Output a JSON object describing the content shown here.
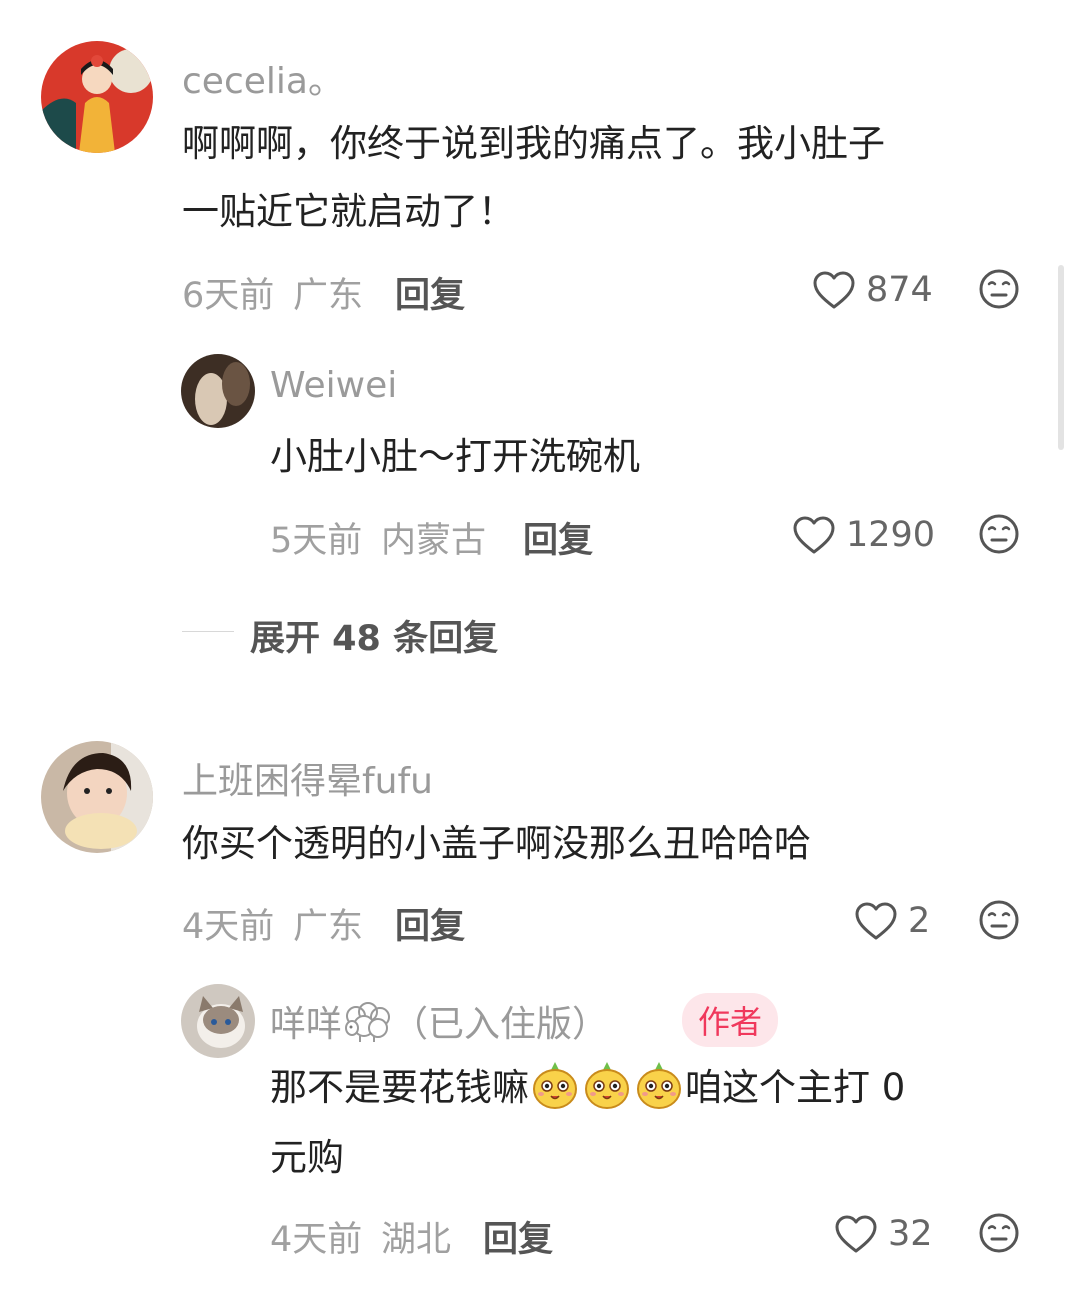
{
  "comments": [
    {
      "user": "cecelia。",
      "text_lines": [
        "啊啊啊，你终于说到我的痛点了。我小肚子",
        "一贴近它就启动了！"
      ],
      "time": "6天前",
      "location": "广东",
      "reply_label": "回复",
      "likes": "874",
      "replies": [
        {
          "user": "Weiwei",
          "text": "小肚小肚～打开洗碗机",
          "time": "5天前",
          "location": "内蒙古",
          "reply_label": "回复",
          "likes": "1290"
        }
      ],
      "expand_label": "展开 48 条回复"
    },
    {
      "user": "上班困得晕fufu",
      "text": "你买个透明的小盖子啊没那么丑哈哈哈",
      "time": "4天前",
      "location": "广东",
      "reply_label": "回复",
      "likes": "2",
      "replies": [
        {
          "user": "咩咩",
          "user_suffix": "（已入住版）",
          "badge": "作者",
          "text_before": "那不是要花钱嘛",
          "text_after": "咱这个主打 0",
          "text_line2": "元购",
          "time": "4天前",
          "location": "湖北",
          "reply_label": "回复",
          "likes": "32"
        }
      ]
    }
  ],
  "colors": {
    "badge_bg": "#fde6ea",
    "badge_text": "#f0385c",
    "meta": "#a0a0a0"
  },
  "icons": [
    "heart-outline-icon",
    "dislike-face-icon",
    "sheep-emoji",
    "cute-face-emoji"
  ]
}
